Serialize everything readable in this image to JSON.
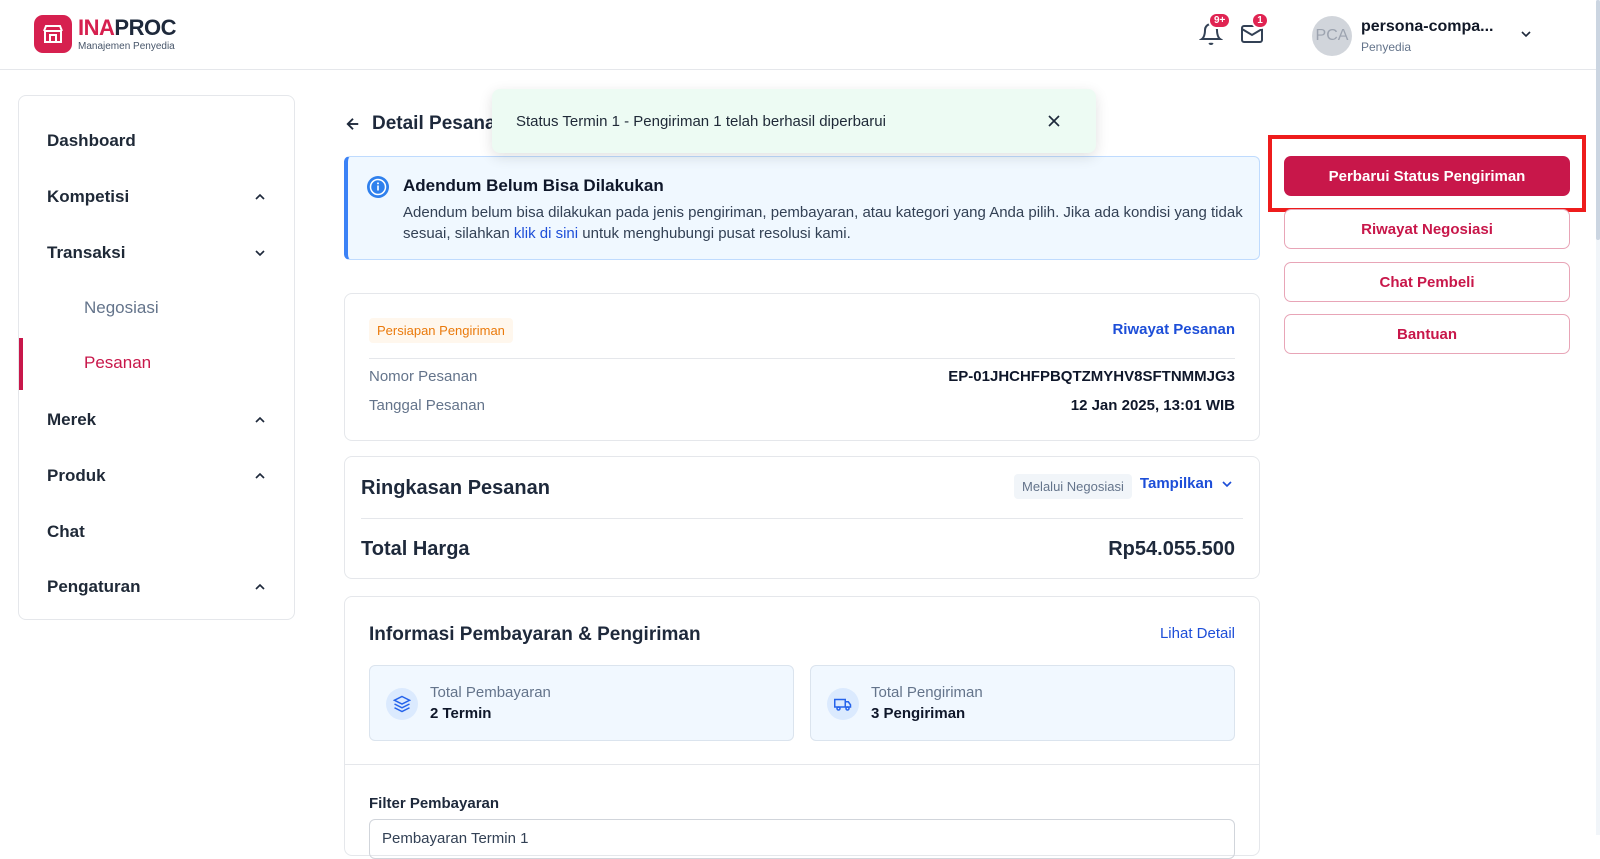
{
  "header": {
    "logo_title_inap": "INA",
    "logo_title_proc": "PROC",
    "logo_subtitle": "Manajemen Penyedia",
    "notifications_badge": "9+",
    "messages_badge": "1",
    "avatar_initials": "PCA",
    "user_name": "persona-compa...",
    "user_role": "Penyedia"
  },
  "sidebar": {
    "items": [
      {
        "label": "Dashboard"
      },
      {
        "label": "Kompetisi"
      },
      {
        "label": "Transaksi"
      },
      {
        "label": "Negosiasi"
      },
      {
        "label": "Pesanan"
      },
      {
        "label": "Merek"
      },
      {
        "label": "Produk"
      },
      {
        "label": "Chat"
      },
      {
        "label": "Pengaturan"
      }
    ]
  },
  "page": {
    "title": "Detail Pesanan"
  },
  "toast": {
    "message": "Status Termin 1 - Pengiriman 1 telah berhasil diperbarui"
  },
  "info": {
    "title": "Adendum Belum Bisa Dilakukan",
    "text_before": "Adendum belum bisa dilakukan pada jenis pengiriman, pembayaran, atau kategori yang Anda pilih. Jika ada kondisi yang tidak sesuai, silahkan ",
    "link": "klik di sini",
    "text_after": " untuk menghubungi pusat resolusi kami."
  },
  "order": {
    "status": "Persiapan Pengiriman",
    "history_link": "Riwayat Pesanan",
    "number_label": "Nomor Pesanan",
    "number_value": "EP-01JHCHFPBQTZMYHV8SFTNMMJG3",
    "date_label": "Tanggal Pesanan",
    "date_value": "12 Jan 2025, 13:01 WIB"
  },
  "summary": {
    "title": "Ringkasan Pesanan",
    "via": "Melalui Negosiasi",
    "toggle": "Tampilkan",
    "total_label": "Total Harga",
    "total_value": "Rp54.055.500"
  },
  "payment": {
    "title": "Informasi Pembayaran & Pengiriman",
    "detail_link": "Lihat Detail",
    "payment_label": "Total Pembayaran",
    "payment_value": "2 Termin",
    "shipping_label": "Total Pengiriman",
    "shipping_value": "3 Pengiriman",
    "filter_label": "Filter Pembayaran",
    "filter_value": "Pembayaran Termin 1"
  },
  "actions": {
    "primary": "Perbarui Status Pengiriman",
    "negotiation_history": "Riwayat Negosiasi",
    "chat_buyer": "Chat Pembeli",
    "help": "Bantuan"
  },
  "colors": {
    "brand": "#c8174a",
    "highlight": "#ee1c1c",
    "link": "#1d4ed8",
    "status_orange": "#ea7a0c"
  }
}
